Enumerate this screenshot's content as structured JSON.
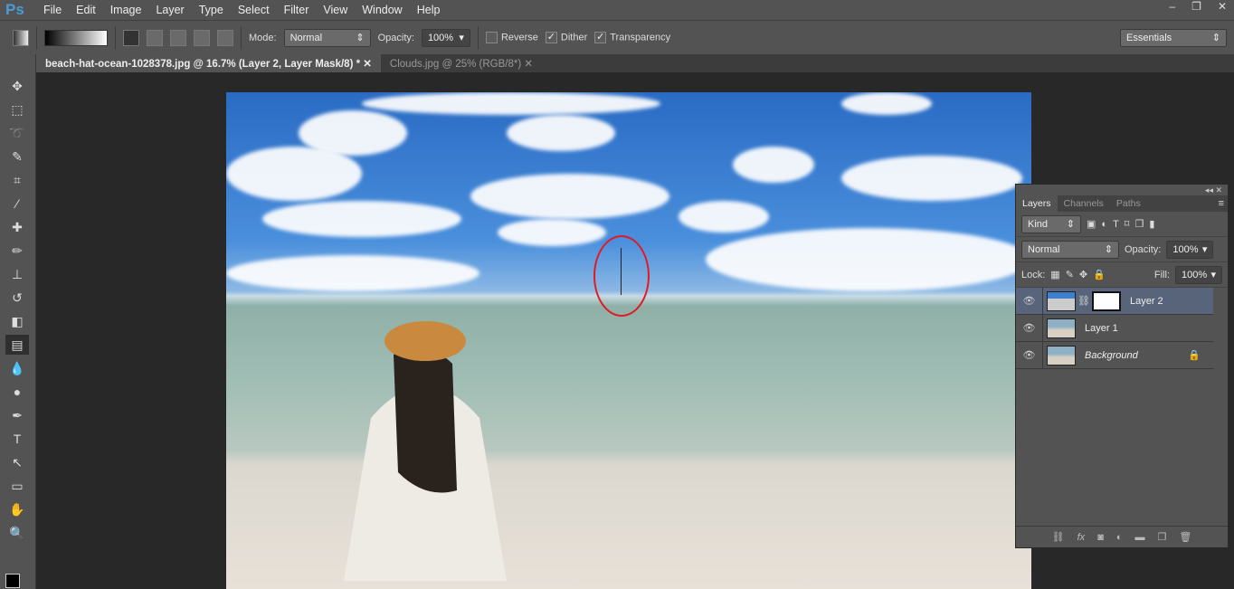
{
  "app": {
    "logo": "Ps"
  },
  "menu": [
    "File",
    "Edit",
    "Image",
    "Layer",
    "Type",
    "Select",
    "Filter",
    "View",
    "Window",
    "Help"
  ],
  "window_buttons": [
    "–",
    "❐",
    "✕"
  ],
  "options": {
    "mode_label": "Mode:",
    "mode_value": "Normal",
    "opacity_label": "Opacity:",
    "opacity_value": "100%",
    "reverse": "Reverse",
    "dither": "Dither",
    "transparency": "Transparency",
    "workspace": "Essentials"
  },
  "tabs": [
    {
      "label": "beach-hat-ocean-1028378.jpg @ 16.7% (Layer 2, Layer Mask/8) *"
    },
    {
      "label": "Clouds.jpg @ 25% (RGB/8*)"
    }
  ],
  "layers_panel": {
    "tabs": [
      "Layers",
      "Channels",
      "Paths"
    ],
    "kind": "Kind",
    "blend": "Normal",
    "opacity_label": "Opacity:",
    "opacity": "100%",
    "lock_label": "Lock:",
    "fill_label": "Fill:",
    "fill": "100%",
    "layers": [
      {
        "name": "Layer 2",
        "active": true
      },
      {
        "name": "Layer 1"
      },
      {
        "name": "Background",
        "locked": true
      }
    ]
  }
}
